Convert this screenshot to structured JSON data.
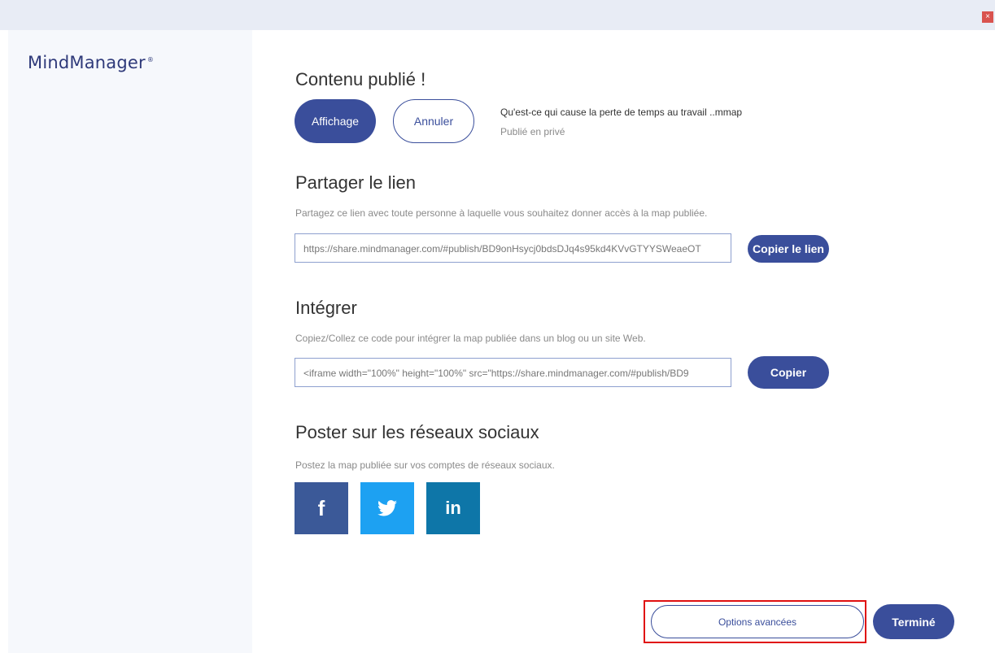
{
  "window": {
    "close_label": "×"
  },
  "sidebar": {
    "logo_text": "MindManager",
    "logo_mark": "®"
  },
  "published": {
    "title": "Contenu publié !",
    "view_button": "Affichage",
    "cancel_button": "Annuler",
    "file_name": "Qu'est-ce qui cause la perte de temps au travail ..mmap",
    "status": "Publié en privé"
  },
  "share": {
    "title": "Partager le lien",
    "description": "Partagez ce lien avec toute personne à laquelle vous souhaitez donner accès à la map publiée.",
    "link_value": "https://share.mindmanager.com/#publish/BD9onHsycj0bdsDJq4s95kd4KVvGTYYSWeaeOT",
    "copy_link_button": "Copier le lien"
  },
  "embed": {
    "title": "Intégrer",
    "description": "Copiez/Collez ce code pour intégrer la map publiée dans un blog ou un site Web.",
    "code_value": "<iframe width=\"100%\" height=\"100%\" src=\"https://share.mindmanager.com/#publish/BD9",
    "copy_button": "Copier"
  },
  "social": {
    "title": "Poster sur les réseaux sociaux",
    "description": "Postez la map publiée sur vos comptes de réseaux sociaux.",
    "facebook_glyph": "f",
    "linkedin_glyph": "in",
    "facebook_color": "#3b5998",
    "twitter_color": "#1da1f2",
    "linkedin_color": "#0e76a8"
  },
  "footer": {
    "advanced_button": "Options avancées",
    "done_button": "Terminé"
  },
  "colors": {
    "accent": "#3a4e9b",
    "highlight": "#e01010"
  }
}
